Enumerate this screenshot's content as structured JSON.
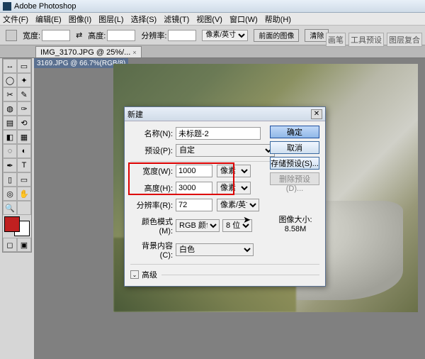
{
  "app": {
    "title": "Adobe Photoshop"
  },
  "menu": {
    "file": "文件(F)",
    "edit": "编辑(E)",
    "image": "图像(I)",
    "layer": "图层(L)",
    "select": "选择(S)",
    "filter": "滤镜(T)",
    "view": "视图(V)",
    "window": "窗口(W)",
    "help": "帮助(H)"
  },
  "optbar": {
    "width_lbl": "宽度:",
    "height_lbl": "高度:",
    "res_lbl": "分辨率:",
    "unit": "像素/英寸",
    "front": "前面的图像",
    "clear": "清除"
  },
  "panels": {
    "a": "画笔",
    "b": "工具预设",
    "c": "图层复合"
  },
  "tabs": [
    {
      "label": "IMG_3170.JPG @ 25%/..."
    },
    {
      "label": "3169.JPG @ 66.7%(RGB/8)"
    }
  ],
  "tools": [
    "▭",
    "▭",
    "⬚",
    "✦",
    "✂",
    "✎",
    "⌨",
    "⟋",
    "✑",
    "◌",
    "✎",
    "▤",
    "⊕",
    "T",
    "▯",
    "⬈",
    "◐",
    "⊙",
    "⊕",
    "Q",
    "✋",
    "🔍"
  ],
  "dialog": {
    "title": "新建",
    "name_lbl": "名称(N):",
    "name_val": "未标题-2",
    "preset_lbl": "预设(P):",
    "preset_val": "自定",
    "width_lbl": "宽度(W):",
    "width_val": "1000",
    "width_unit": "像素",
    "height_lbl": "高度(H):",
    "height_val": "3000",
    "height_unit": "像素",
    "res_lbl": "分辨率(R):",
    "res_val": "72",
    "res_unit": "像素/英寸",
    "mode_lbl": "颜色模式(M):",
    "mode_val": "RGB 颜色",
    "bits": "8 位",
    "bg_lbl": "背景内容(C):",
    "bg_val": "白色",
    "adv": "高级",
    "size_lbl": "图像大小:",
    "size_val": "8.58M",
    "ok": "确定",
    "cancel": "取消",
    "save": "存储预设(S)...",
    "del": "删除预设(D)..."
  }
}
